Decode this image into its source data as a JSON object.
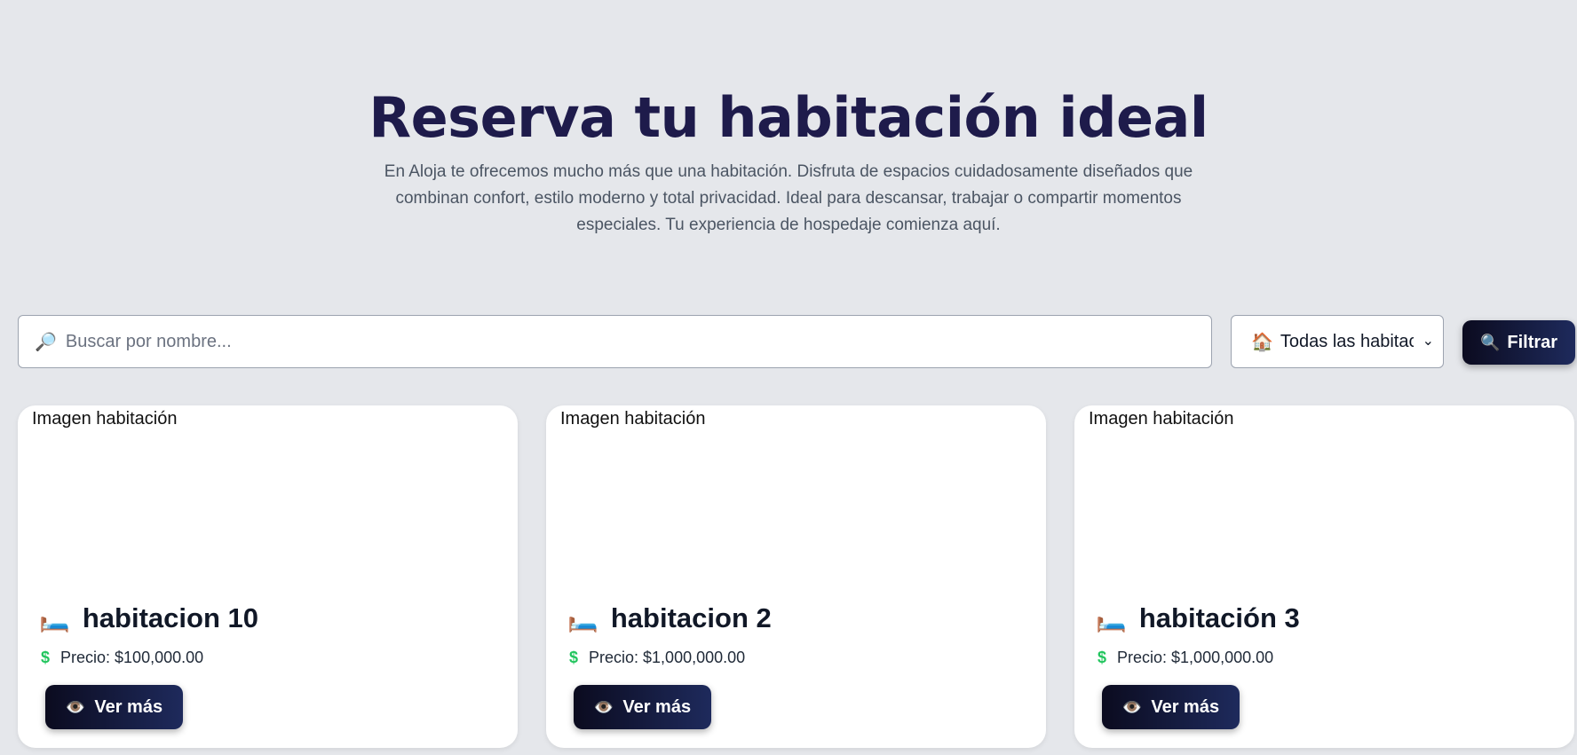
{
  "hero": {
    "title": "Reserva tu habitación ideal",
    "description": "En Aloja te ofrecemos mucho más que una habitación. Disfruta de espacios cuidadosamente diseñados que combinan confort, estilo moderno y total privacidad. Ideal para descansar, trabajar o compartir momentos especiales. Tu experiencia de hospedaje comienza aquí."
  },
  "search": {
    "icon": "magnifier-icon",
    "placeholder": "Buscar por nombre...",
    "value": ""
  },
  "filter_select": {
    "icon": "house-icon",
    "selected": "Todas las habitac"
  },
  "filter_button": {
    "icon": "magnifier-icon",
    "label": "Filtrar"
  },
  "cards": [
    {
      "image_alt": "Imagen habitación",
      "name": "habitacion 10",
      "price": "Precio: $100,000.00",
      "button": "Ver más"
    },
    {
      "image_alt": "Imagen habitación",
      "name": "habitacion 2",
      "price": "Precio: $1,000,000.00",
      "button": "Ver más"
    },
    {
      "image_alt": "Imagen habitación",
      "name": "habitación 3",
      "price": "Precio: $1,000,000.00",
      "button": "Ver más"
    }
  ],
  "icons": {
    "bed": "bed-icon",
    "price": "dollar-icon",
    "view": "eye-icon"
  },
  "colors": {
    "background": "#e5e7eb",
    "title": "#1e1b4b",
    "button_start": "#0b0b1f",
    "button_end": "#1e2a5c",
    "price_icon": "#22c55e"
  }
}
